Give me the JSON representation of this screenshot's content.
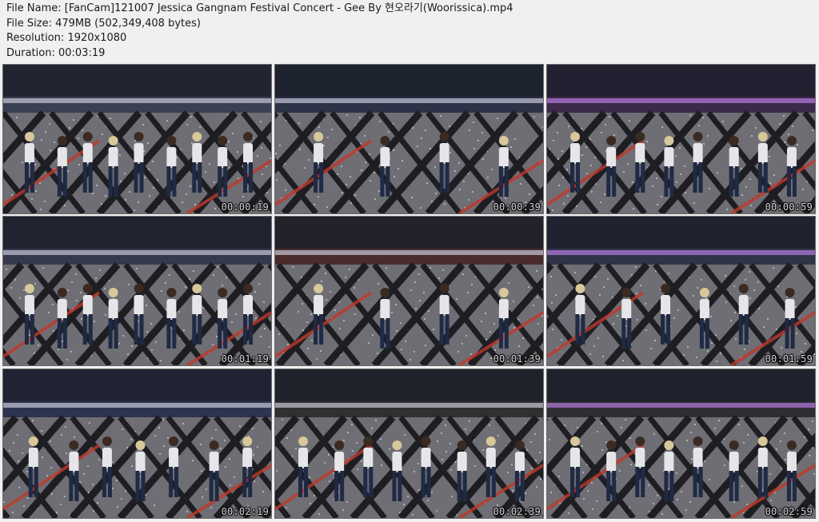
{
  "file_info": {
    "name": "File Name: [FanCam]121007 Jessica Gangnam Festival Concert - Gee By 현오라기(Woorissica).mp4",
    "size": "File Size: 479MB (502,349,408 bytes)",
    "resolution": "Resolution: 1920x1080",
    "duration": "Duration: 00:03:19"
  },
  "thumbnails": [
    {
      "timestamp": "00:00:19",
      "performers": 9,
      "tint": "#3a3f52"
    },
    {
      "timestamp": "00:00:39",
      "performers": 4,
      "tint": "#2c3348"
    },
    {
      "timestamp": "00:00:59",
      "performers": 8,
      "tint": "#3d2a4a"
    },
    {
      "timestamp": "00:01:19",
      "performers": 9,
      "tint": "#35394d"
    },
    {
      "timestamp": "00:01:39",
      "performers": 4,
      "tint": "#4a2c2c"
    },
    {
      "timestamp": "00:01:59",
      "performers": 6,
      "tint": "#2f3447"
    },
    {
      "timestamp": "00:02:19",
      "performers": 7,
      "tint": "#2d3450"
    },
    {
      "timestamp": "00:02:39",
      "performers": 8,
      "tint": "#303030"
    },
    {
      "timestamp": "00:02:59",
      "performers": 8,
      "tint": "#2e2e34"
    }
  ]
}
